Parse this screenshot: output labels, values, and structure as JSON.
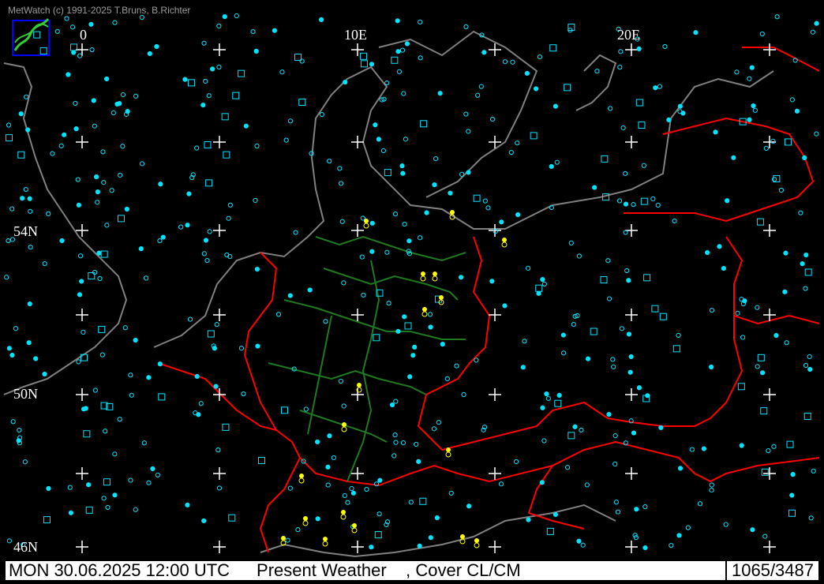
{
  "credit": "MetWatch  (c) 1991-2025 T.Bruns, B.Richter",
  "lon_labels": [
    "0",
    "10E",
    "20E"
  ],
  "lat_labels": [
    "54N",
    "50N",
    "46N"
  ],
  "status": {
    "datetime": "MON 30.06.2025 12:00 UTC",
    "product": "Present Weather    , Cover CL/CM",
    "counter": "1065/3487"
  },
  "colors": {
    "background": "#000000",
    "coastline": "#808080",
    "country_border": "#ff0000",
    "state_border": "#1f7a1f",
    "station": "#00e5ff",
    "weather_symbol": "#ffff00",
    "grid": "#ffffff"
  },
  "icons": [
    "metwatch-logo-icon",
    "station-circle-icon",
    "cloud-square-icon",
    "weather-symbol-icon"
  ]
}
